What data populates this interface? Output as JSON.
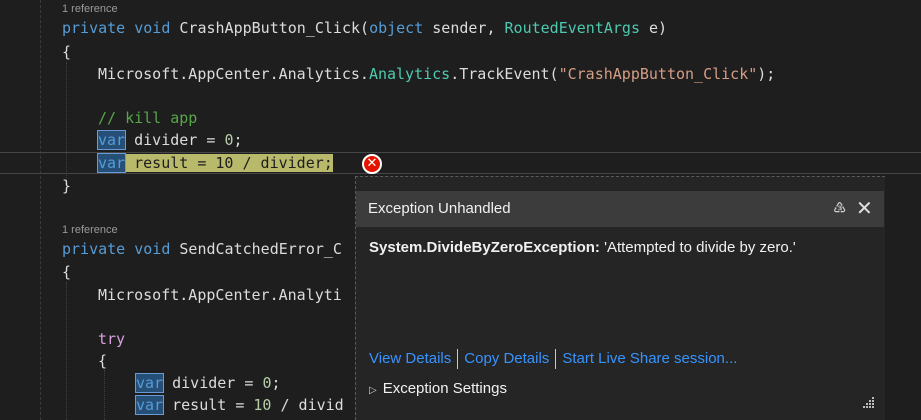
{
  "editor": {
    "codelens_refs_1": "1 reference",
    "codelens_refs_2": "1 reference",
    "line1": {
      "modifier": "private",
      "ret": "void",
      "name": "CrashAppButton_Click",
      "open": "(",
      "p1type": "object",
      "p1name": " sender, ",
      "p2type": "RoutedEventArgs",
      "p2name": " e)"
    },
    "brace_open_1": "{",
    "line_track": {
      "prefix": "Microsoft.AppCenter.Analytics.",
      "cls": "Analytics",
      "method": ".TrackEvent(",
      "str": "\"CrashAppButton_Click\"",
      "end": ");"
    },
    "comment": "// kill app",
    "line_div": {
      "kw": "var",
      "rest": " divider = ",
      "num": "0",
      "end": ";"
    },
    "line_res": {
      "kw": "var",
      "sp": " ",
      "rest": "result = 10 / divider;"
    },
    "brace_close_1": "}",
    "line2": {
      "modifier": "private",
      "ret": "void",
      "name": "SendCatchedError_C"
    },
    "brace_open_2": "{",
    "line_track2": "Microsoft.AppCenter.Analyti",
    "try_kw": "try",
    "brace_open_3": "{",
    "line_div2": {
      "kw": "var",
      "rest": " divider = ",
      "num": "0",
      "end": ";"
    },
    "line_res2": {
      "kw": "var",
      "rest": " result = ",
      "num": "10",
      "rest2": " / divid"
    }
  },
  "popup": {
    "title": "Exception Unhandled",
    "pin_glyph": "♵",
    "close_glyph": "✕",
    "exception_type": "System.DivideByZeroException:",
    "exception_message": " 'Attempted to divide by zero.'",
    "link_view_details": "View Details",
    "link_copy_details": "Copy Details",
    "link_live_share": "Start Live Share session...",
    "settings_label": "Exception Settings",
    "settings_chevron": "▷"
  },
  "colors": {
    "background": "#1e1e1e",
    "keyword": "#569cd6",
    "type": "#4ec9b0",
    "string": "#d69d85",
    "comment": "#57a64a",
    "error_highlight": "#b8b96a",
    "link": "#3794ff",
    "error_icon": "#e51400"
  },
  "icons": {
    "error": "error-circle-x-icon",
    "pin": "pin-icon",
    "close": "close-icon",
    "expand": "chevron-right-icon",
    "resize": "resize-grip-icon"
  }
}
